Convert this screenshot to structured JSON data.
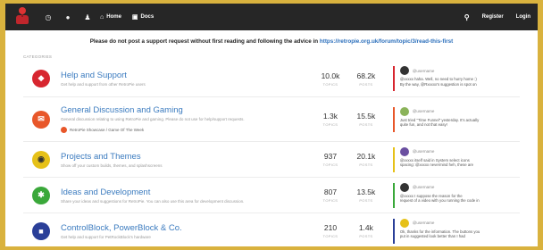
{
  "navbar": {
    "links": [
      {
        "label": "Home",
        "icon": "home-icon"
      },
      {
        "label": "Docs",
        "icon": "book-icon"
      }
    ],
    "register": "Register",
    "login": "Login"
  },
  "notice": {
    "text": "Please do not post a support request without first reading and following the advice in",
    "link": "https://retropie.org.uk/forum/topic/3/read-this-first"
  },
  "categories_heading": "CATEGORIES",
  "labels": {
    "topics": "TOPICS",
    "posts": "POSTS"
  },
  "categories": [
    {
      "title": "Help and Support",
      "description": "Get help and support from other RetroPie users",
      "topics": "10.0k",
      "posts": "68.2k",
      "color": "#d7262f",
      "icon": "life-ring-icon",
      "latest_user": "@username",
      "latest_text": [
        "@xxxxx haha. Well, no need to hurry home :)",
        "By the way, @Rxxxxx's suggestion is spot on"
      ]
    },
    {
      "title": "General Discussion and Gaming",
      "description": "General discussion relating to using RetroPie and gaming. Please do not use for help/support requests.",
      "topics": "1.3k",
      "posts": "15.5k",
      "color": "#e8572a",
      "icon": "chat-icon",
      "sub_category": "RetroPie Showcase / Game Of The Week",
      "latest_user": "@username",
      "latest_text": [
        "Just tried \"Time Funnel\" yesterday. It's actually",
        "quite fun, and not that easy!"
      ]
    },
    {
      "title": "Projects and Themes",
      "description": "Show off your custom builds, themes, and splashscreens",
      "topics": "937",
      "posts": "20.1k",
      "color": "#e6c119",
      "icon": "gamepad-icon",
      "latest_user": "@username",
      "latest_text": [
        "@xxxxx itself said in System select icons",
        "spacing: @xxxxx nevermind heh, these are"
      ]
    },
    {
      "title": "Ideas and Development",
      "description": "Share your ideas and suggestions for RetroPie. You can also use this area for development discussion.",
      "topics": "807",
      "posts": "13.5k",
      "color": "#3aa83a",
      "icon": "lightbulb-icon",
      "latest_user": "@username",
      "latest_text": [
        "@xxxxx I suppose the reason for the",
        "request of a video with you running the code in"
      ]
    },
    {
      "title": "ControlBlock, PowerBlock & Co.",
      "description": "Get help and support for PetRockBlock's hardware",
      "topics": "210",
      "posts": "1.4k",
      "color": "#2a3f98",
      "icon": "chip-icon",
      "latest_user": "@username",
      "latest_text": [
        "Ok, thanks for the information. The buttons you",
        "put in suggested look better than I had"
      ]
    }
  ]
}
